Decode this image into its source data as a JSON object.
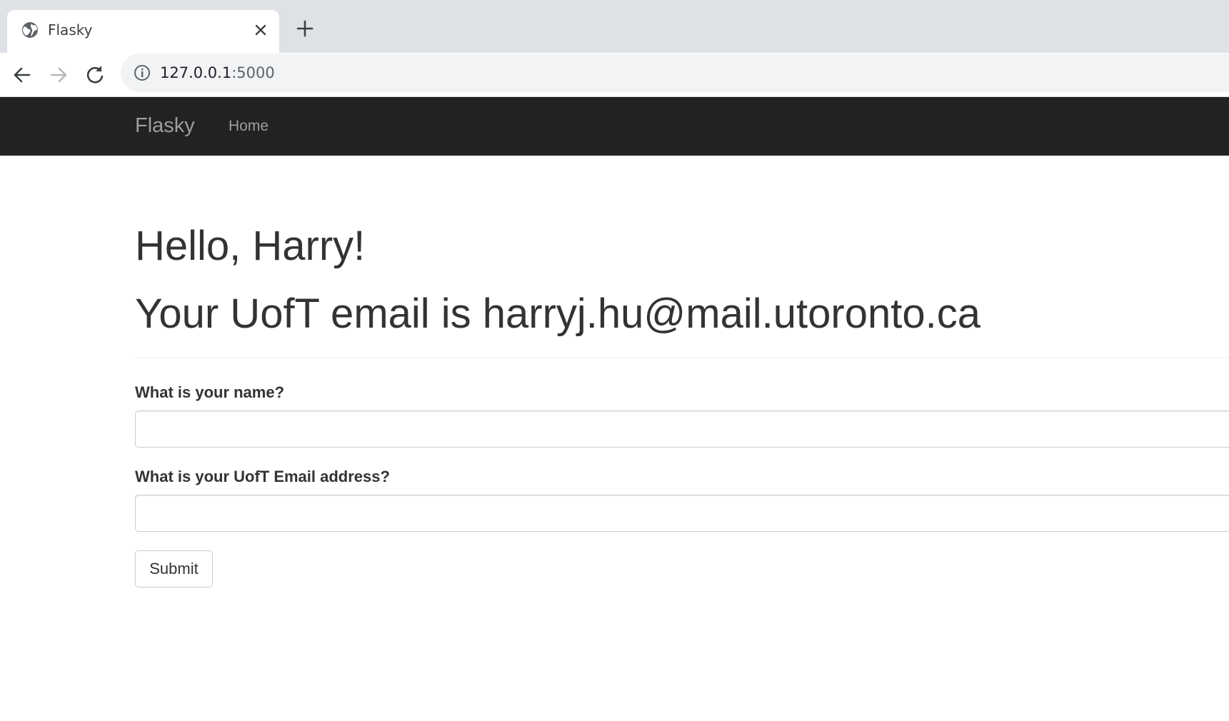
{
  "browser": {
    "tab": {
      "title": "Flasky",
      "favicon": "globe-icon",
      "close_icon": "close-icon"
    },
    "new_tab_icon": "plus-icon",
    "nav": {
      "back_icon": "arrow-left-icon",
      "forward_icon": "arrow-right-icon",
      "reload_icon": "reload-icon"
    },
    "address_bar": {
      "info_icon": "info-icon",
      "host": "127.0.0.1",
      "port": ":5000"
    }
  },
  "navbar": {
    "brand": "Flasky",
    "links": [
      {
        "label": "Home"
      }
    ],
    "background": "#222222",
    "text_color": "#9d9d9d"
  },
  "page": {
    "greeting": "Hello, Harry!",
    "email_line": "Your UofT email is harryj.hu@mail.utoronto.ca",
    "form": {
      "name_label": "What is your name?",
      "name_value": "",
      "email_label": "What is your UofT Email address?",
      "email_value": "",
      "submit_label": "Submit"
    }
  }
}
